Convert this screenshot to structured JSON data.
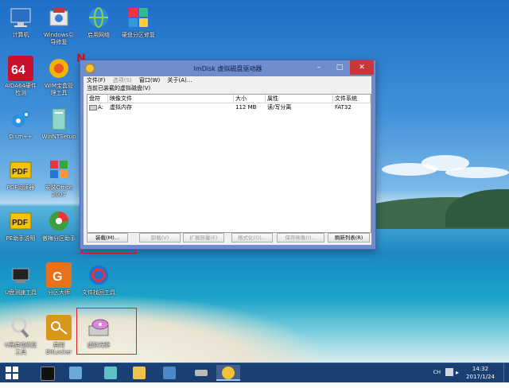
{
  "desktop": {
    "icons": [
      {
        "label": "计算机",
        "icon": "computer-icon"
      },
      {
        "label": "Windows引\n导修复",
        "icon": "boot-repair-icon"
      },
      {
        "label": "启用网络",
        "icon": "network-globe-icon"
      },
      {
        "label": "硬盘分区修复",
        "icon": "disk-repair-icon"
      },
      {
        "label": "AIDA64硬件\n检测",
        "icon": "aida64-icon"
      },
      {
        "label": "WIM宝盒管\n理工具",
        "icon": "wim-tool-icon"
      },
      {
        "label": "Dism++",
        "icon": "dism-gear-icon"
      },
      {
        "label": "WinNTSetup",
        "icon": "winntsetup-icon"
      },
      {
        "label": "PDF阅读器",
        "icon": "pdf-reader-icon"
      },
      {
        "label": "安装Office\n2007",
        "icon": "office-install-icon"
      },
      {
        "label": "PE助手说明",
        "icon": "pdf-help-icon"
      },
      {
        "label": "傲梅分区助手",
        "icon": "partition-assistant-icon"
      },
      {
        "label": "U盘测速工具",
        "icon": "usb-speed-icon"
      },
      {
        "label": "分区大师",
        "icon": "diskgenius-icon"
      },
      {
        "label": "文件找回工具",
        "icon": "file-recovery-icon"
      },
      {
        "label": "U盘启动修复\n工具",
        "icon": "usb-boot-repair-icon"
      },
      {
        "label": "启用\nBitLocker",
        "icon": "bitlocker-key-icon"
      },
      {
        "label": "虚拟光驱",
        "icon": "virtual-drive-icon"
      }
    ],
    "n_icon_label": "N"
  },
  "window": {
    "title": "ImDisk 虚拟磁盘驱动器",
    "menu": {
      "file": "文件(F)",
      "options": "选项(S)",
      "window": "窗口(W)",
      "about": "关于(A)..."
    },
    "list_caption": "当前已装载的虚拟磁盘(V)",
    "columns": [
      "盘符",
      "映像文件",
      "大小",
      "属性",
      "文件系统"
    ],
    "rows": [
      {
        "drive": "A:",
        "image": "虚拟内存",
        "size": "112 MB",
        "attr": "读/写分离",
        "fs": "FAT32"
      }
    ],
    "buttons": {
      "mount": "装载(M)...",
      "unmount": "卸载(V)",
      "extend": "扩展容量(E)",
      "format": "格式化(O)...",
      "save": "保存映像(I)...",
      "refresh": "刷新列表(R)"
    }
  },
  "taskbar": {
    "ime": "CH",
    "time": "14:32",
    "date": "2017/1/24"
  },
  "colors": {
    "title_blue": "#6f8ccc",
    "close_red": "#c9373a",
    "highlight_red": "#e0202a",
    "taskbar": "#1a3f73"
  }
}
